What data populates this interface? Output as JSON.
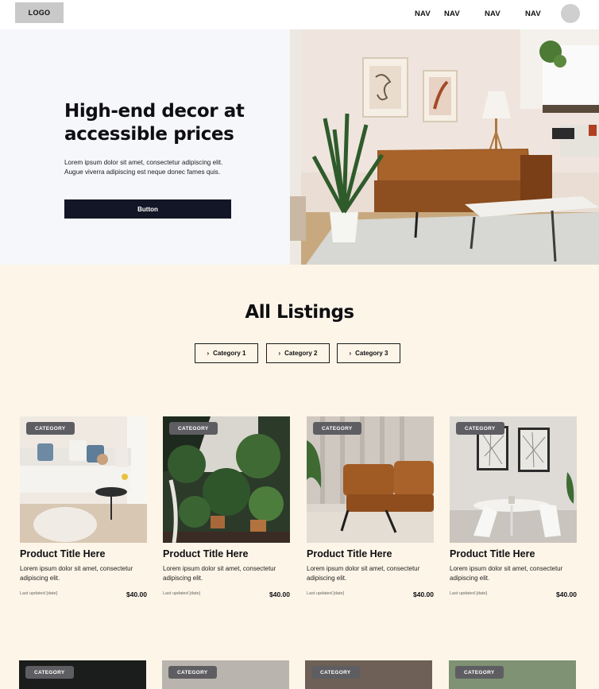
{
  "header": {
    "logo": "LOGO",
    "nav": [
      "NAV",
      "NAV",
      "NAV",
      "NAV"
    ]
  },
  "hero": {
    "title": "High-end decor at accessible prices",
    "text": "Lorem ipsum dolor sit amet, consectetur adipiscing elit. Augue viverra adipiscing est neque donec fames quis.",
    "button": "Button"
  },
  "listings": {
    "title": "All Listings",
    "categories": [
      "Category 1",
      "Category 2",
      "Category 3"
    ],
    "cards": [
      {
        "badge": "CATEGORY",
        "title": "Product Title Here",
        "desc": "Lorem ipsum dolor sit amet, consectetur adipiscing elit.",
        "updated": "Last updated [date]",
        "price": "$40.00"
      },
      {
        "badge": "CATEGORY",
        "title": "Product Title Here",
        "desc": "Lorem ipsum dolor sit amet, consectetur adipiscing elit.",
        "updated": "Last updated [date]",
        "price": "$40.00"
      },
      {
        "badge": "CATEGORY",
        "title": "Product Title Here",
        "desc": "Lorem ipsum dolor sit amet, consectetur adipiscing elit.",
        "updated": "Last updated [date]",
        "price": "$40.00"
      },
      {
        "badge": "CATEGORY",
        "title": "Product Title Here",
        "desc": "Lorem ipsum dolor sit amet, consectetur adipiscing elit.",
        "updated": "Last updated [date]",
        "price": "$40.00"
      }
    ],
    "second_row_badges": [
      "CATEGORY",
      "CATEGORY",
      "CATEGORY",
      "CATEGORY"
    ]
  },
  "colors": {
    "page_bg": "#fdf5e8",
    "hero_bg": "#f6f7fa",
    "button_bg": "#131626",
    "badge_bg": "#5e5e62"
  }
}
